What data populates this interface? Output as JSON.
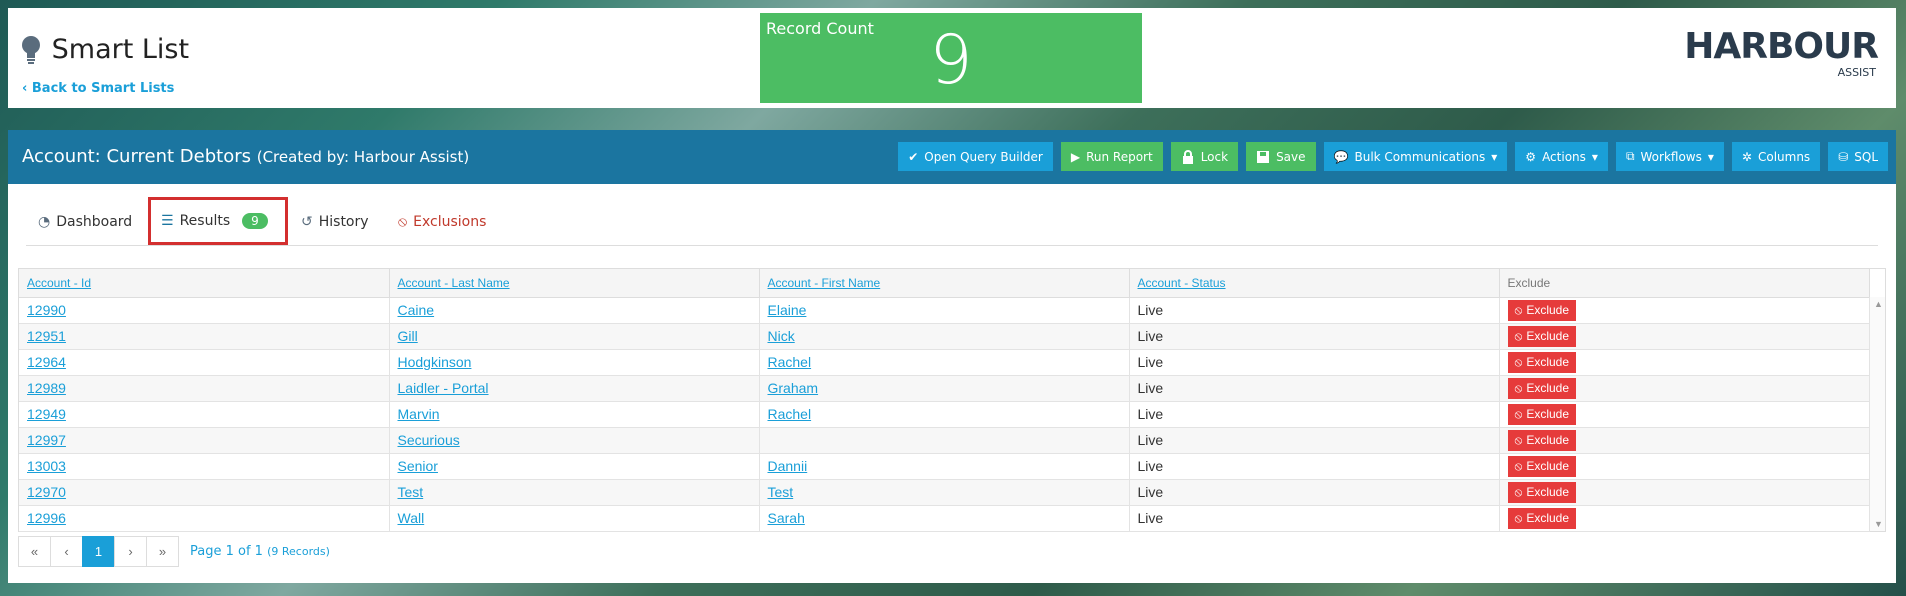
{
  "header": {
    "title": "Smart List",
    "back_link": "Back to Smart Lists",
    "record_count_label": "Record Count",
    "record_count_value": "9",
    "logo_main": "HARBOUR",
    "logo_sub": "ASSIST"
  },
  "panel": {
    "title": "Account: Current Debtors",
    "created_by": "(Created by: Harbour Assist)",
    "toolbar": {
      "query_builder": "Open Query Builder",
      "run_report": "Run Report",
      "lock": "Lock",
      "save": "Save",
      "bulk_comms": "Bulk Communications",
      "actions": "Actions",
      "workflows": "Workflows",
      "columns": "Columns",
      "sql": "SQL"
    }
  },
  "tabs": {
    "dashboard": "Dashboard",
    "results": "Results",
    "results_count": "9",
    "history": "History",
    "exclusions": "Exclusions"
  },
  "table": {
    "headers": [
      "Account - Id",
      "Account - Last Name",
      "Account - First Name",
      "Account - Status",
      "Exclude"
    ],
    "exclude_label": "Exclude",
    "rows": [
      [
        "12990",
        "Caine",
        "Elaine",
        "Live"
      ],
      [
        "12951",
        "Gill",
        "Nick",
        "Live"
      ],
      [
        "12964",
        "Hodgkinson",
        "Rachel",
        "Live"
      ],
      [
        "12989",
        "Laidler - Portal",
        "Graham",
        "Live"
      ],
      [
        "12949",
        "Marvin",
        "Rachel",
        "Live"
      ],
      [
        "12997",
        "Securious",
        "",
        "Live"
      ],
      [
        "13003",
        "Senior",
        "Dannii",
        "Live"
      ],
      [
        "12970",
        "Test",
        "Test",
        "Live"
      ],
      [
        "12996",
        "Wall",
        "Sarah",
        "Live"
      ]
    ]
  },
  "pager": {
    "first": "«",
    "prev": "‹",
    "current": "1",
    "next": "›",
    "last": "»",
    "info": "Page 1 of 1",
    "records": "(9 Records)"
  },
  "colors": {
    "primary": "#1a9fd8",
    "header": "#1b75a0",
    "green": "#4cbd63",
    "danger": "#e63b3b"
  }
}
